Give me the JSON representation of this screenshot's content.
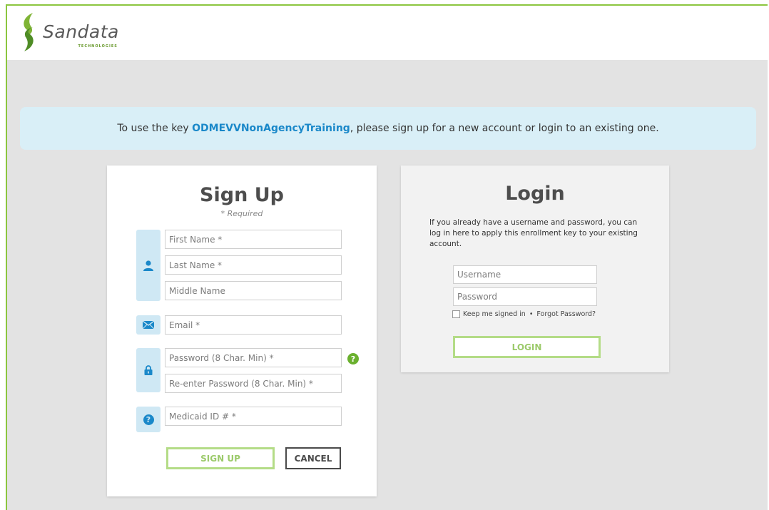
{
  "brand": {
    "name": "Sandata",
    "tagline": "TECHNOLOGIES",
    "colors": {
      "green": "#8cc63f",
      "blue": "#1a88c9",
      "light_blue": "#d9eff7"
    }
  },
  "banner": {
    "prefix": "To use the key ",
    "key": "ODMEVVNonAgencyTraining",
    "suffix": ", please sign up for a new account or login to an existing one."
  },
  "signup": {
    "title": "Sign Up",
    "required_note": "* Required",
    "fields": {
      "first_name": "First Name *",
      "last_name": "Last Name *",
      "middle_name": "Middle Name",
      "email": "Email *",
      "password": "Password (8 Char. Min) *",
      "reenter_password": "Re-enter Password (8 Char. Min) *",
      "medicaid_id": "Medicaid ID # *"
    },
    "password_help": "?",
    "signup_button": "SIGN UP",
    "cancel_button": "CANCEL",
    "icons": [
      "user-icon",
      "envelope-icon",
      "lock-icon",
      "question-icon"
    ]
  },
  "login": {
    "title": "Login",
    "description": "If you already have a username and password, you can log in here to apply this enrollment key to your existing account.",
    "username_placeholder": "Username",
    "password_placeholder": "Password",
    "keep_signed_in": "Keep me signed in",
    "separator": "•",
    "forgot_password": "Forgot Password?",
    "login_button": "LOGIN"
  }
}
